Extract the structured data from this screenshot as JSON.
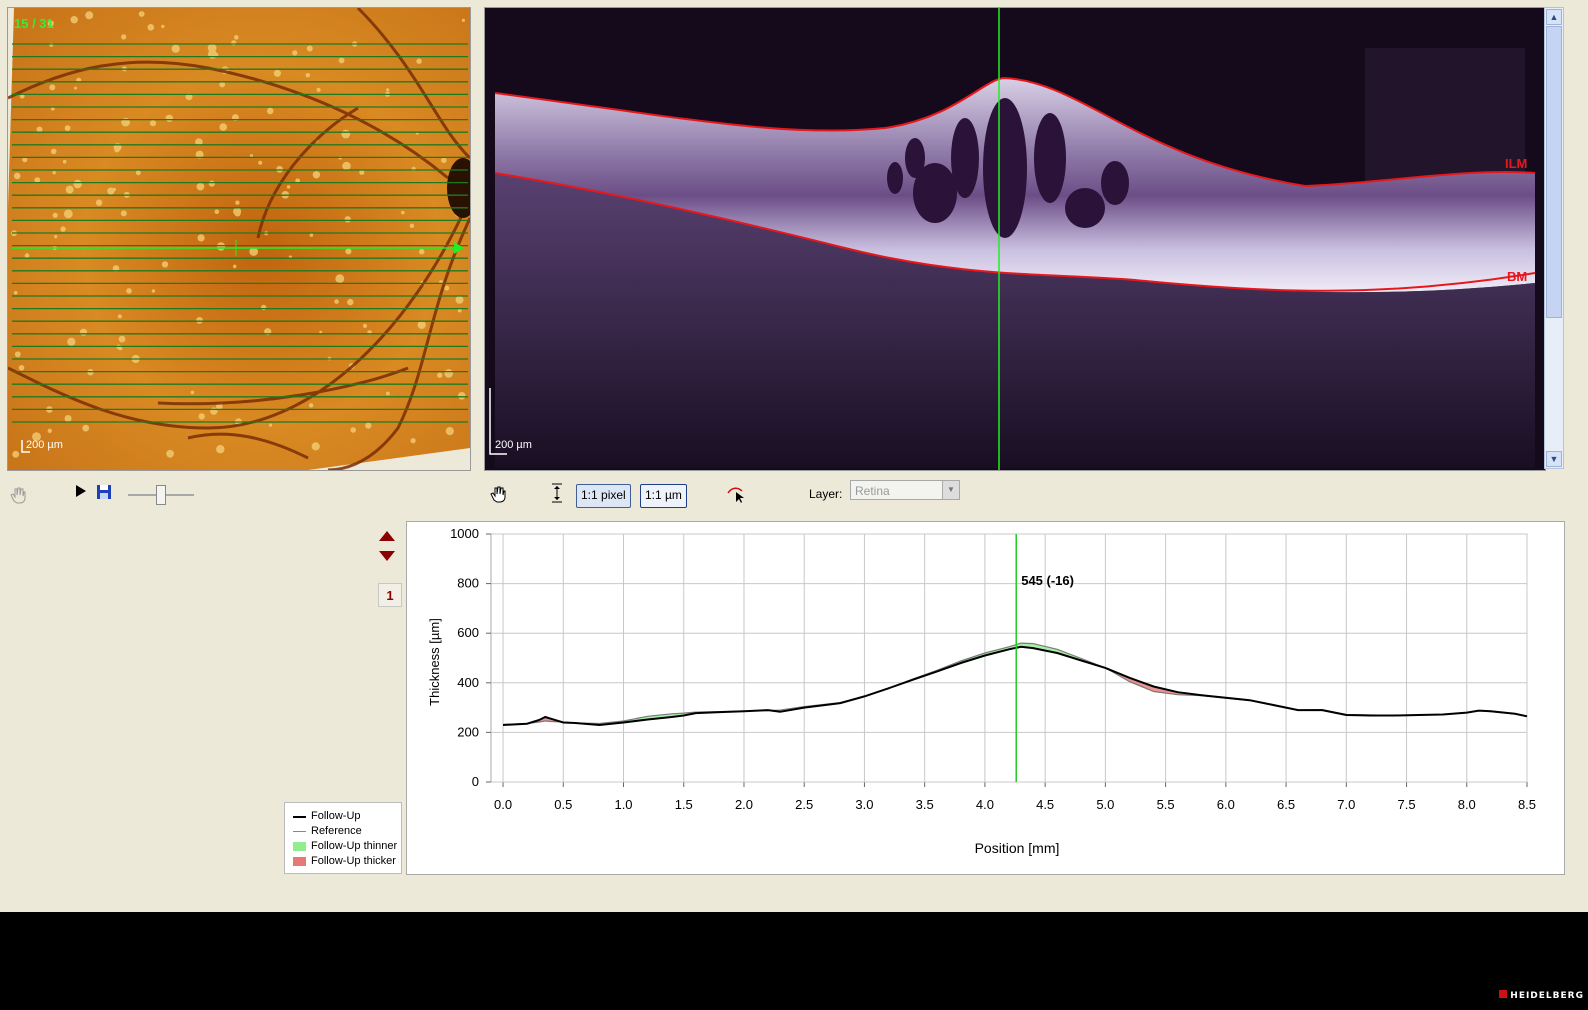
{
  "fundus": {
    "scan_index": "15 / 31",
    "scale_label": "200 µm"
  },
  "bscan": {
    "scale_label": "200 µm",
    "layer_top": "ILM",
    "layer_bottom": "BM"
  },
  "toolbar": {
    "pixel_label": "1:1 pixel",
    "um_label": "1:1 µm",
    "layer_label": "Layer:",
    "layer_value": "Retina"
  },
  "side": {
    "page_number": "1"
  },
  "legend": {
    "items": [
      "Follow-Up",
      "Reference",
      "Follow-Up thinner",
      "Follow-Up thicker"
    ]
  },
  "chart_data": {
    "type": "line",
    "xlabel": "Position [mm]",
    "ylabel": "Thickness [µm]",
    "xlim": [
      -0.1,
      8.5
    ],
    "ylim": [
      0,
      1000
    ],
    "x_ticks": [
      "0.0",
      "0.5",
      "1.0",
      "1.5",
      "2.0",
      "2.5",
      "3.0",
      "3.5",
      "4.0",
      "4.5",
      "5.0",
      "5.5",
      "6.0",
      "6.5",
      "7.0",
      "7.5",
      "8.0",
      "8.5"
    ],
    "y_ticks": [
      "0",
      "200",
      "400",
      "600",
      "800",
      "1000"
    ],
    "cursor": {
      "x": 4.26,
      "label": "545 (-16)"
    },
    "x": [
      0.0,
      0.2,
      0.3,
      0.35,
      0.4,
      0.5,
      0.6,
      0.8,
      1.0,
      1.2,
      1.4,
      1.5,
      1.6,
      1.8,
      2.0,
      2.2,
      2.3,
      2.5,
      2.8,
      3.0,
      3.2,
      3.4,
      3.6,
      3.8,
      4.0,
      4.2,
      4.3,
      4.4,
      4.6,
      4.8,
      5.0,
      5.2,
      5.4,
      5.6,
      5.8,
      6.0,
      6.2,
      6.4,
      6.6,
      6.8,
      7.0,
      7.2,
      7.4,
      7.6,
      7.8,
      8.0,
      8.1,
      8.2,
      8.4,
      8.5
    ],
    "series": [
      {
        "name": "Follow-Up",
        "color": "#000000",
        "values": [
          230,
          235,
          250,
          262,
          255,
          240,
          238,
          230,
          240,
          252,
          262,
          268,
          278,
          282,
          285,
          290,
          283,
          300,
          318,
          345,
          378,
          412,
          445,
          480,
          510,
          535,
          545,
          540,
          520,
          490,
          460,
          420,
          385,
          362,
          350,
          340,
          330,
          310,
          290,
          290,
          270,
          268,
          268,
          270,
          272,
          280,
          288,
          285,
          275,
          265
        ]
      },
      {
        "name": "Reference",
        "color": "#7a7a7a",
        "values": [
          232,
          236,
          242,
          246,
          244,
          242,
          238,
          236,
          246,
          265,
          275,
          278,
          282,
          284,
          286,
          288,
          290,
          304,
          320,
          345,
          378,
          415,
          450,
          488,
          520,
          545,
          560,
          558,
          535,
          498,
          460,
          405,
          365,
          352,
          348,
          338,
          328,
          308,
          290,
          292,
          272,
          270,
          269,
          270,
          272,
          279,
          287,
          284,
          274,
          264
        ]
      }
    ]
  }
}
